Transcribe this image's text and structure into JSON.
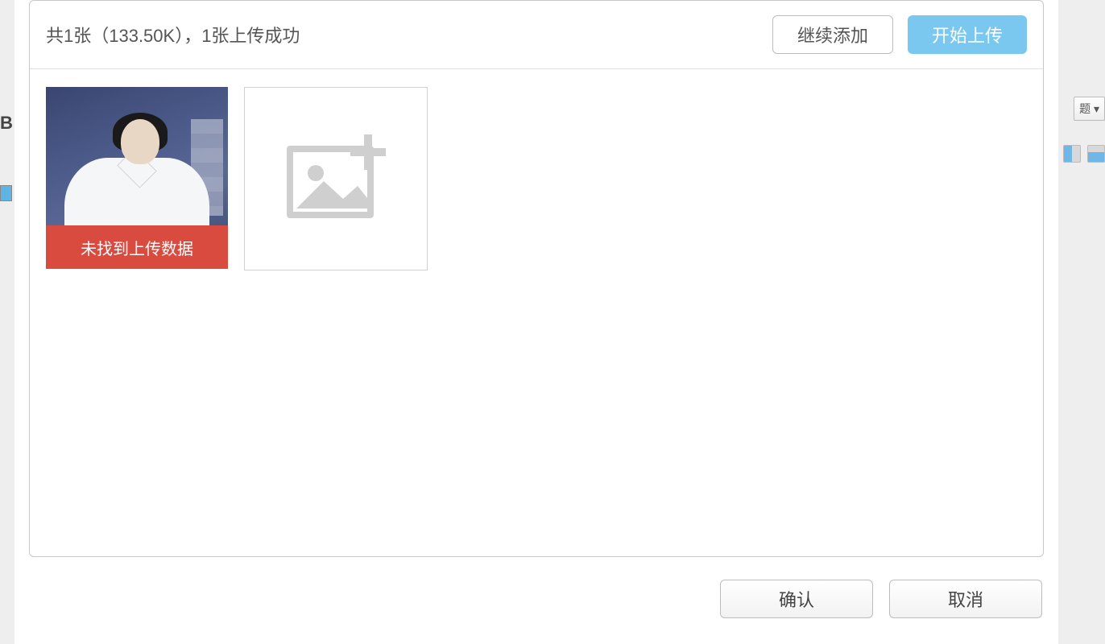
{
  "header": {
    "status_text": "共1张（133.50K），1张上传成功",
    "continue_add_label": "继续添加",
    "start_upload_label": "开始上传"
  },
  "thumbs": {
    "error_label": "未找到上传数据"
  },
  "footer": {
    "confirm_label": "确认",
    "cancel_label": "取消"
  },
  "background": {
    "dropdown_label": "题",
    "dropdown_arrow": "▾"
  }
}
